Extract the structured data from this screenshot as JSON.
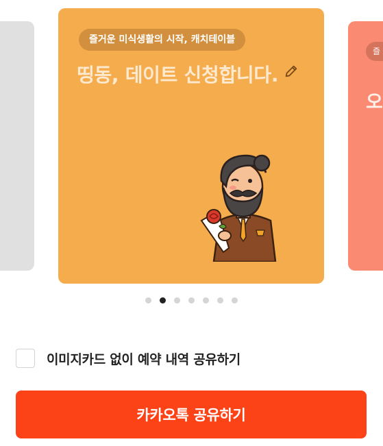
{
  "carousel": {
    "cards": [
      {
        "tagline": "즐거운 미식생활의 시작, 캐치테이블",
        "title": "띵동, 데이트 신청합니다.",
        "background": "#f5ac4c"
      }
    ],
    "right_peek": {
      "tagline": "즐",
      "title": "오",
      "background": "#fa8a72"
    },
    "left_peek": {
      "background": "#e0e0e0"
    },
    "page_count": 7,
    "active_index": 1,
    "icons": {
      "edit": "pencil-icon",
      "illustration": "gentleman-with-rose"
    }
  },
  "options": {
    "no_image_card_label": "이미지카드 없이 예약 내역 공유하기",
    "checked": false
  },
  "actions": {
    "share_label": "카카오톡 공유하기",
    "accent": "#fc4217"
  }
}
